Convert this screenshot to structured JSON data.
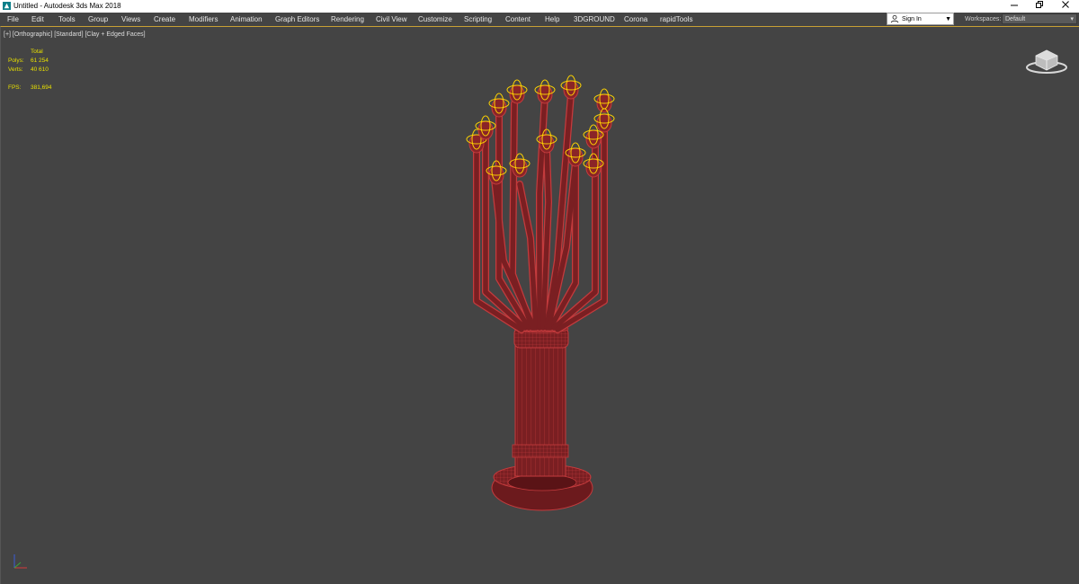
{
  "window": {
    "title": "Untitled - Autodesk 3ds Max 2018",
    "app_icon": "3dsmax-logo-icon",
    "controls": [
      "minimize-icon",
      "restore-icon",
      "close-icon"
    ]
  },
  "menu": {
    "items": [
      "File",
      "Edit",
      "Tools",
      "Group",
      "Views",
      "Create",
      "Modifiers",
      "Animation",
      "Graph Editors",
      "Rendering",
      "Civil View",
      "Customize",
      "Scripting",
      "Content",
      "Help",
      "3DGROUND",
      "Corona",
      "rapidTools"
    ]
  },
  "signin": {
    "label": "Sign In",
    "icon": "user-icon"
  },
  "workspaces": {
    "label": "Workspaces:",
    "value": "Default"
  },
  "viewport": {
    "label": "[+] [Orthographic] [Standard] [Clay + Edged Faces]",
    "stats": {
      "header": "Total",
      "polys_label": "Polys:",
      "polys_value": "61 254",
      "verts_label": "Verts:",
      "verts_value": "40 610",
      "fps_label": "FPS:",
      "fps_value": "381,694"
    },
    "colors": {
      "background": "#444444",
      "mesh": "#7a1f22",
      "wire": "#c43b3d",
      "selection": "#ffd400",
      "stats_text": "#e8e000"
    }
  }
}
